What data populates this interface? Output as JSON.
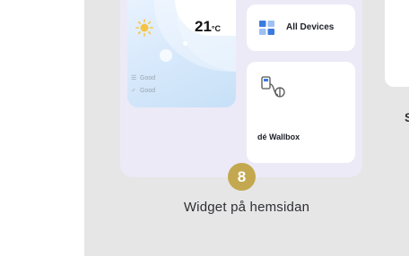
{
  "weather": {
    "temperature": "21",
    "unit": "°C",
    "status_1": "Good",
    "status_2": "Good"
  },
  "devices": {
    "label": "All Devices"
  },
  "wallbox": {
    "label": "dé Wallbox"
  },
  "step": {
    "number": "8"
  },
  "caption": "Widget på hemsidan",
  "next_caption": "S",
  "colors": {
    "badge": "#c3a84f",
    "panel_bg": "#e6e6e6",
    "widget_bg": "#eceaf7",
    "sun": "#f5c542",
    "devices_icon": "#3a7be0"
  }
}
